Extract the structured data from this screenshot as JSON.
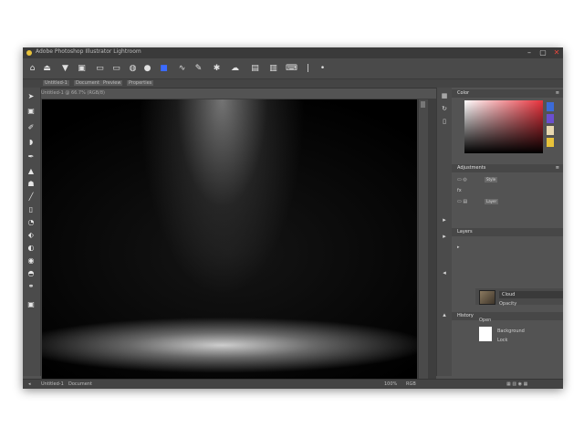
{
  "window": {
    "title": "Adobe Photoshop Illustrator Lightroom"
  },
  "titlebar": {
    "minimize_label": "–",
    "maximize_label": "▢",
    "close_label": "✕"
  },
  "toolbar": {
    "icons": [
      "home-icon",
      "filter-icon",
      "select-icon",
      "stamp-icon",
      "monitor-icon",
      "layer-icon",
      "globe-icon",
      "pin-icon",
      "save-icon",
      "wave-icon",
      "brush-icon",
      "paw-icon",
      "cloud-icon",
      "graph-icon",
      "scanner-icon",
      "divider-icon",
      "dot-icon"
    ]
  },
  "options": {
    "items": [
      "Untitled-1",
      "Document",
      "Preview",
      "Properties"
    ],
    "sub_label": "Untitled-1 @ 66.7% (RGB/8)"
  },
  "left_tools": {
    "icons": [
      "arrow-icon",
      "marquee-icon",
      "lasso-icon",
      "brush-icon",
      "pen-icon",
      "eraser-icon",
      "fill-icon",
      "eyedropper-icon",
      "bucket-icon",
      "crop-icon",
      "text-icon",
      "zoom-icon",
      "hand-icon",
      "gradient-icon",
      "swap-icon",
      "mask-icon"
    ]
  },
  "color_panel": {
    "title": "Color",
    "menu": "≡",
    "swatches": [
      "#3b6bd8",
      "#6b4fd0",
      "#e8d8b0",
      "#e8c23a"
    ]
  },
  "properties_panel": {
    "title": "Adjustments",
    "menu": "≡",
    "row1_label": "Style",
    "row2_label": "fx",
    "row3_label": "Layer"
  },
  "layers_panel": {
    "title": "Layers",
    "layer_name": "Cloud",
    "opacity_label": "Opacity",
    "row_a": "Background",
    "row_b": "Lock",
    "lower_title": "History",
    "lower_sub": "Open"
  },
  "status": {
    "left1": "Untitled-1",
    "left2": "Document",
    "right1": "100%",
    "right2": "RGB"
  },
  "accent": {
    "window_bg": "#535353",
    "canvas_bg": "#000000",
    "close_red": "#e6463c"
  }
}
